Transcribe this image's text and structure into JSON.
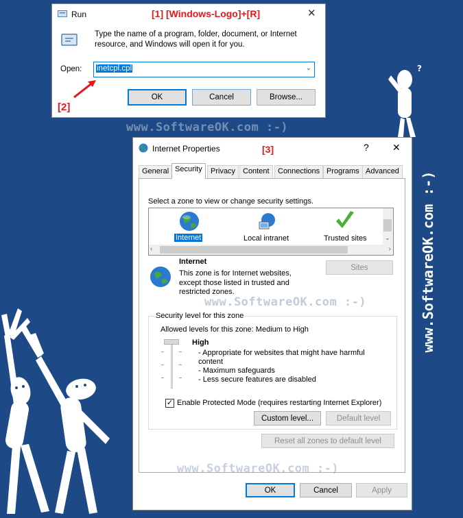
{
  "annotations": {
    "step1": "[1] [Windows-Logo]+[R]",
    "step2": "[2]",
    "step3": "[3]"
  },
  "watermarks": {
    "text": "www.SoftwareOK.com :-)",
    "vertical": "www.SoftwareOK.com :-)"
  },
  "run_dialog": {
    "title": "Run",
    "description": "Type the name of a program, folder, document, or Internet resource, and Windows will open it for you.",
    "open_label": "Open:",
    "open_value": "inetcpl.cpl",
    "ok_label": "OK",
    "cancel_label": "Cancel",
    "browse_label": "Browse..."
  },
  "ie_dialog": {
    "title": "Internet Properties",
    "help_glyph": "?",
    "close_glyph": "✕",
    "tabs": [
      "General",
      "Security",
      "Privacy",
      "Content",
      "Connections",
      "Programs",
      "Advanced"
    ],
    "zone_prompt": "Select a zone to view or change security settings.",
    "zones": [
      {
        "label": "Internet",
        "icon": "globe-icon"
      },
      {
        "label": "Local intranet",
        "icon": "intranet-icon"
      },
      {
        "label": "Trusted sites",
        "icon": "checkmark-icon"
      }
    ],
    "selected_zone_title": "Internet",
    "selected_zone_desc": "This zone is for Internet websites, except those listed in trusted and restricted zones.",
    "sites_label": "Sites",
    "security_level_legend": "Security level for this zone",
    "allowed_levels": "Allowed levels for this zone: Medium to High",
    "level_name": "High",
    "level_bullets": [
      "- Appropriate for websites that might have harmful content",
      "- Maximum safeguards",
      "- Less secure features are disabled"
    ],
    "protected_mode_label": "Enable Protected Mode (requires restarting Internet Explorer)",
    "protected_mode_checked": true,
    "custom_level_label": "Custom level...",
    "default_level_label": "Default level",
    "reset_all_label": "Reset all zones to default level",
    "ok_label": "OK",
    "cancel_label": "Cancel",
    "apply_label": "Apply"
  }
}
